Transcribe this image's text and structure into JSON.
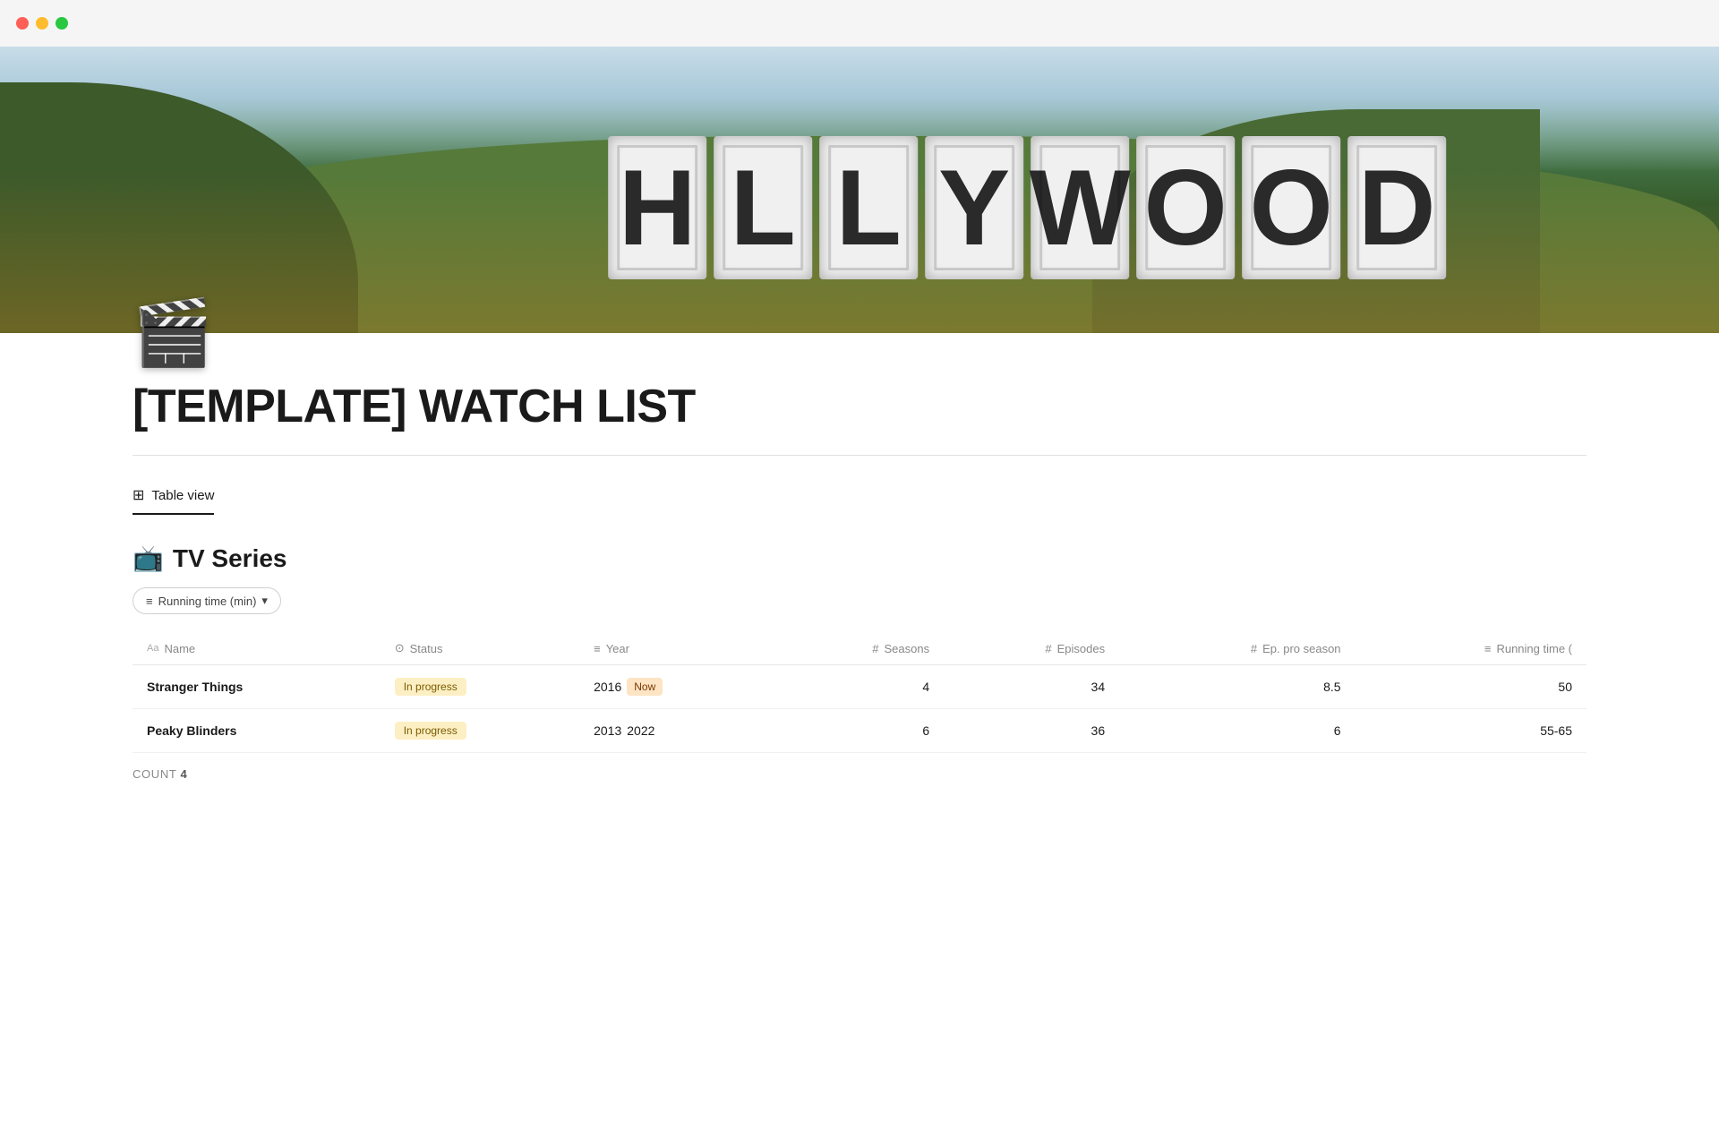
{
  "window": {
    "controls": {
      "close_label": "close",
      "minimize_label": "minimize",
      "maximize_label": "maximize"
    }
  },
  "hero": {
    "letters": [
      "H",
      "L",
      "L",
      "Y",
      "W",
      "O",
      "O",
      "D"
    ]
  },
  "page": {
    "icon": "🎬",
    "title": "[TEMPLATE] WATCH LIST"
  },
  "tabs": [
    {
      "label": "Table view",
      "icon": "⊞",
      "active": true
    }
  ],
  "section": {
    "icon": "📺",
    "title": "TV Series"
  },
  "filter": {
    "label": "Running time (min)",
    "icon": "≡"
  },
  "table": {
    "columns": [
      {
        "icon": "Aa",
        "label": "Name"
      },
      {
        "icon": "⊙",
        "label": "Status"
      },
      {
        "icon": "≡",
        "label": "Year"
      },
      {
        "icon": "#",
        "label": "Seasons"
      },
      {
        "icon": "#",
        "label": "Episodes"
      },
      {
        "icon": "#",
        "label": "Ep. pro season"
      },
      {
        "icon": "≡",
        "label": "Running time ("
      }
    ],
    "rows": [
      {
        "name": "Stranger Things",
        "status": "In progress",
        "status_type": "in-progress",
        "year_start": "2016",
        "year_end": "Now",
        "year_end_badge": true,
        "seasons": 4,
        "episodes": 34,
        "ep_per_season": 8.5,
        "running_time": 50
      },
      {
        "name": "Peaky Blinders",
        "status": "In progress",
        "status_type": "in-progress",
        "year_start": "2013",
        "year_end": "2022",
        "year_end_badge": false,
        "seasons": 6,
        "episodes": 36,
        "ep_per_season": 6,
        "running_time": "55-65"
      }
    ],
    "count_label": "COUNT",
    "count_value": "4"
  }
}
